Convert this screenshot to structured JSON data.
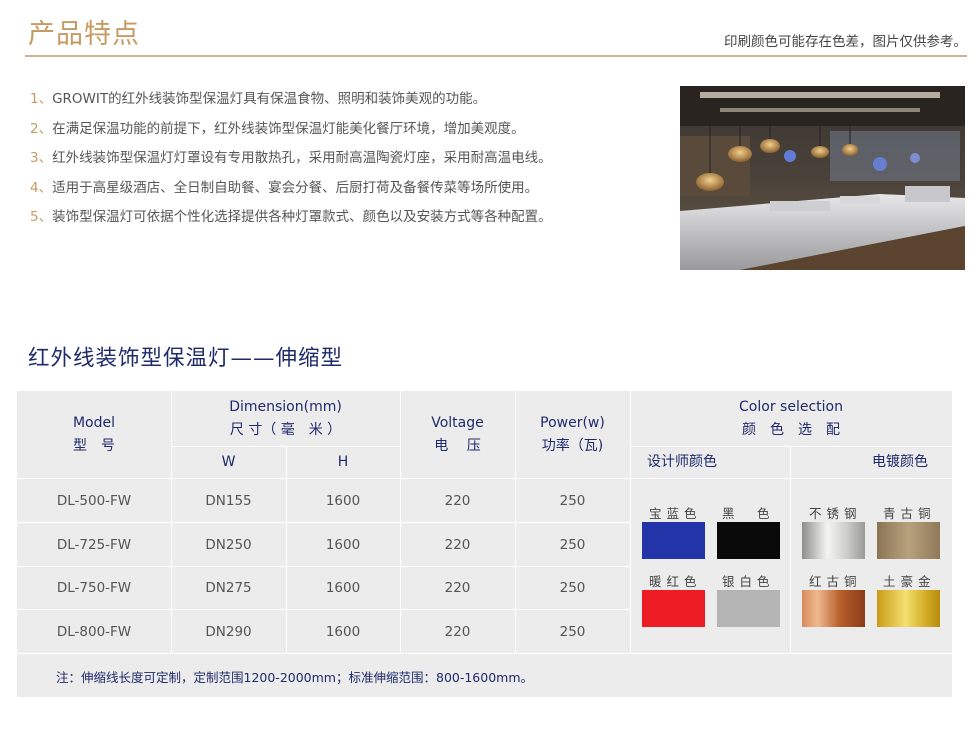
{
  "header": {
    "title": "产品特点",
    "note": "印刷颜色可能存在色差，图片仅供参考。"
  },
  "features": [
    {
      "num": "1、",
      "text": "GROWIT的红外线装饰型保温灯具有保温食物、照明和装饰美观的功能。"
    },
    {
      "num": "2、",
      "text": "在满足保温功能的前提下，红外线装饰型保温灯能美化餐厅环境，增加美观度。"
    },
    {
      "num": "3、",
      "text": "红外线装饰型保温灯灯罩设有专用散热孔，采用耐高温陶瓷灯座，采用耐高温电线。"
    },
    {
      "num": "4、",
      "text": "适用于高星级酒店、全日制自助餐、宴会分餐、后厨打荷及备餐传菜等场所使用。"
    },
    {
      "num": "5、",
      "text": "装饰型保温灯可依据个性化选择提供各种灯罩款式、颜色以及安装方式等各种配置。"
    }
  ],
  "product_title": "红外线装饰型保温灯——伸缩型",
  "table": {
    "headers": {
      "model_en": "Model",
      "model_cn": "型　号",
      "dimension_en": "Dimension(mm)",
      "dimension_cn": "尺 寸（ 毫　米 ）",
      "w": "W",
      "h": "H",
      "voltage_en": "Voltage",
      "voltage_cn": "电　 压",
      "power_en": "Power(w)",
      "power_cn": "功率（瓦)",
      "color_en": "Color selection",
      "color_cn": "颜　色　选　配",
      "designer": "设计师颜色",
      "plating": "电镀颜色"
    },
    "rows": [
      {
        "model": "DL-500-FW",
        "w": "DN155",
        "h": "1600",
        "voltage": "220",
        "power": "250"
      },
      {
        "model": "DL-725-FW",
        "w": "DN250",
        "h": "1600",
        "voltage": "220",
        "power": "250"
      },
      {
        "model": "DL-750-FW",
        "w": "DN275",
        "h": "1600",
        "voltage": "220",
        "power": "250"
      },
      {
        "model": "DL-800-FW",
        "w": "DN290",
        "h": "1600",
        "voltage": "220",
        "power": "250"
      }
    ],
    "swatches": [
      {
        "label": "宝蓝色",
        "color": "#2334a8"
      },
      {
        "label": "黑　色",
        "color": "#0a0a0a"
      },
      {
        "label": "不锈钢",
        "color": "#c8c8c4"
      },
      {
        "label": "青古铜",
        "color": "#a08a68"
      },
      {
        "label": "暖红色",
        "color": "#ee1c25"
      },
      {
        "label": "银白色",
        "color": "#b4b4b4"
      },
      {
        "label": "红古铜",
        "color": "#c77440"
      },
      {
        "label": "土豪金",
        "color": "#d4b02a"
      }
    ],
    "note": "注：伸缩线长度可定制，定制范围1200-2000mm；标准伸缩范围：800-1600mm。"
  },
  "colors": {
    "accent_gold": "#c79a62",
    "title_navy": "#1f2a6b",
    "table_bg": "#ececec"
  }
}
